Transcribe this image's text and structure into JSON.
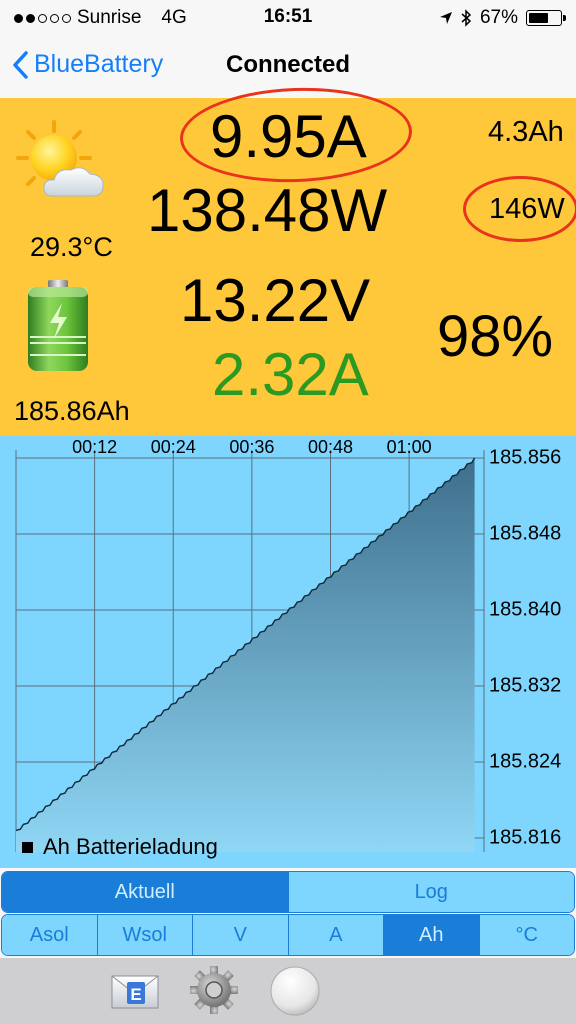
{
  "status_bar": {
    "carrier": "Sunrise",
    "network": "4G",
    "time": "16:51",
    "battery_percent": "67%",
    "battery_level": 0.67
  },
  "nav": {
    "back_label": "BlueBattery",
    "title": "Connected"
  },
  "panel": {
    "solar_current": "9.95A",
    "solar_power": "138.48W",
    "battery_voltage": "13.22V",
    "battery_current": "2.32A",
    "solar_ah": "4.3Ah",
    "peak_power": "146W",
    "state_of_charge": "98%",
    "temperature": "29.3°C",
    "battery_ah": "185.86Ah",
    "colors": {
      "background": "#ffc83a",
      "highlight_ellipse": "#e8341c",
      "battery_current": "#2a9a22"
    }
  },
  "chart_data": {
    "type": "area",
    "x_tick_labels": [
      "00:12",
      "00:24",
      "00:36",
      "00:48",
      "01:00"
    ],
    "y_tick_labels": [
      "185.856",
      "185.848",
      "185.840",
      "185.832",
      "185.824",
      "185.816"
    ],
    "ylim": [
      185.816,
      185.856
    ],
    "x_minutes": [
      0,
      70
    ],
    "series": [
      {
        "name": "Ah Batterieladung",
        "start": 185.8168,
        "end": 185.856
      }
    ],
    "legend": "Ah Batterieladung",
    "grid": true,
    "colors": {
      "background": "#7ed6ff",
      "fill_top": "#3e6f8c",
      "fill_bottom": "#8fd7f5",
      "grid": "#5a6f7c"
    }
  },
  "tabs_main": [
    {
      "label": "Aktuell",
      "active": true
    },
    {
      "label": "Log",
      "active": false
    }
  ],
  "tabs_series": [
    {
      "label": "Asol",
      "active": false
    },
    {
      "label": "Wsol",
      "active": false
    },
    {
      "label": "V",
      "active": false
    },
    {
      "label": "A",
      "active": false
    },
    {
      "label": "Ah",
      "active": true
    },
    {
      "label": "°C",
      "active": false
    }
  ],
  "toolbar": {
    "icons": [
      "email-icon",
      "settings-gear-icon",
      "connection-status-icon"
    ]
  }
}
